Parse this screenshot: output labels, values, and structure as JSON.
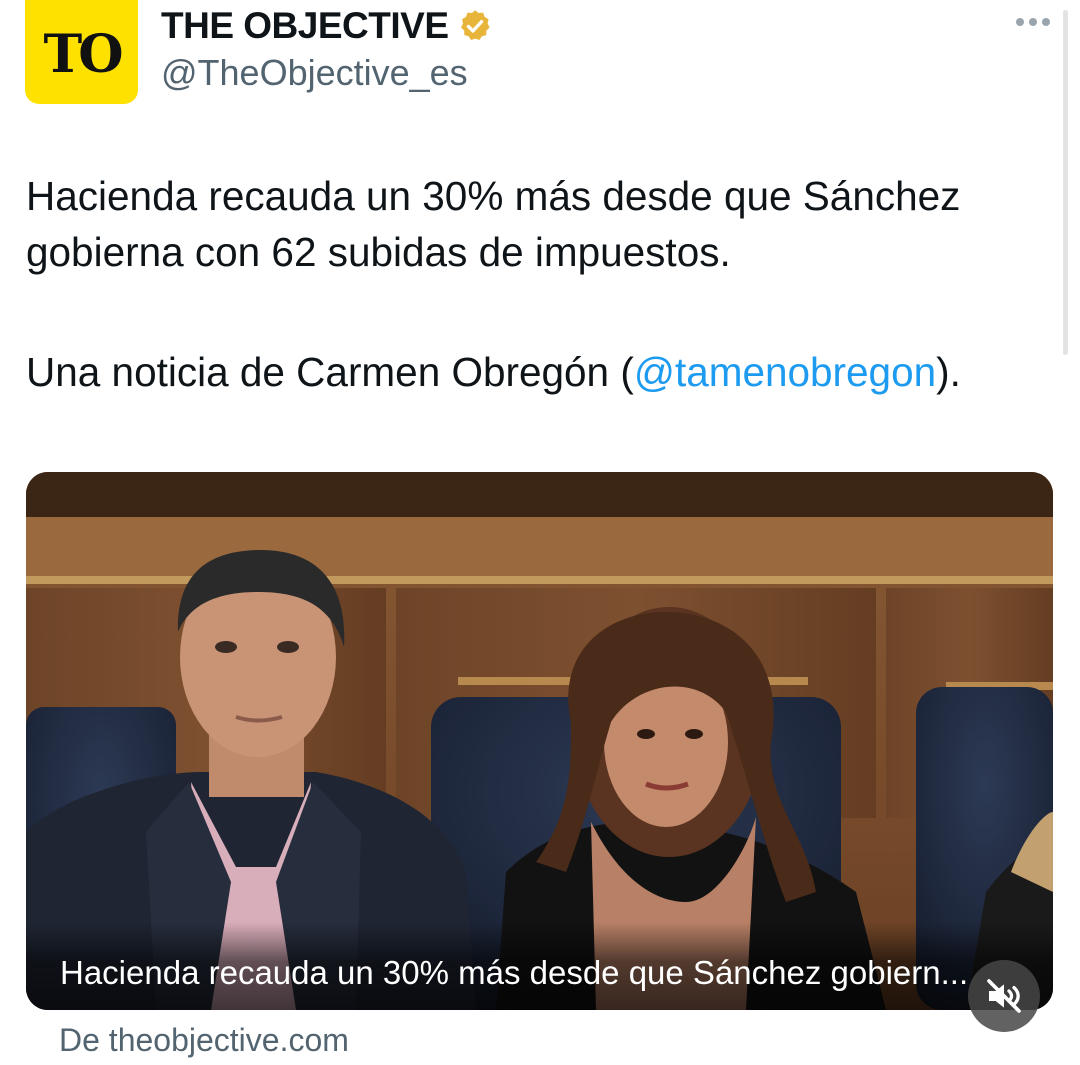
{
  "account": {
    "logo_text": "TO",
    "display_name": "THE OBJECTIVE",
    "handle": "@TheObjective_es",
    "verified_icon": "verified-badge-icon"
  },
  "tweet": {
    "line1": "Hacienda recauda un 30% más desde que Sánchez gobierna con 62 subidas de impuestos.",
    "line2_prefix": "Una noticia de Carmen Obregón (",
    "mention": "@tamenobregon",
    "line2_suffix": ")."
  },
  "media": {
    "caption": "Hacienda recauda un 30% más desde que Sánchez gobiern...",
    "mute_icon": "muted-speaker-icon"
  },
  "link_source": "De theobjective.com",
  "colors": {
    "brand_yellow": "#ffe100",
    "mention_blue": "#1d9bf0",
    "verified_gold": "#e8b53b",
    "secondary_text": "#536471"
  }
}
